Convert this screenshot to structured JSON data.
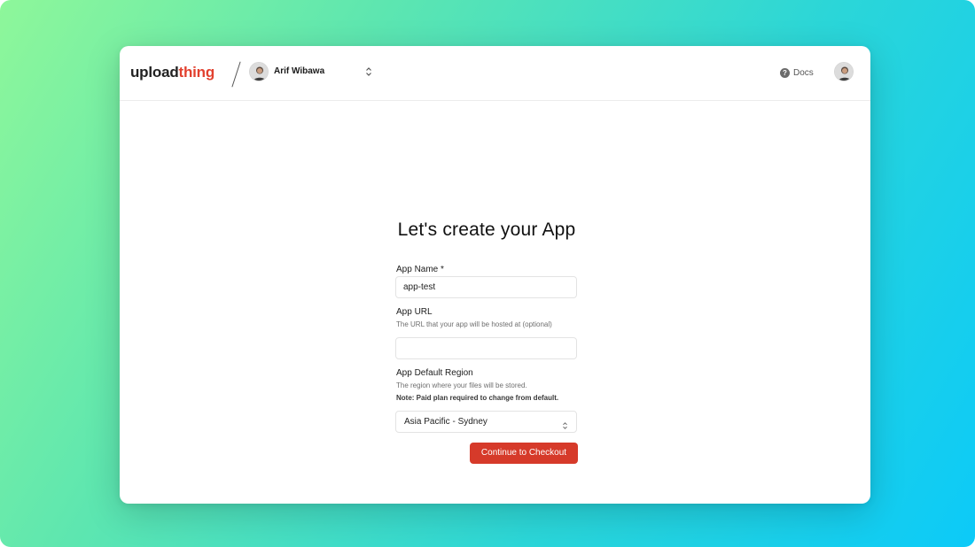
{
  "brand": {
    "logo_part1": "upload",
    "logo_part2": "thing",
    "accent": "#e2412f"
  },
  "account": {
    "name": "Arif Wibawa"
  },
  "header": {
    "docs_label": "Docs"
  },
  "form": {
    "title": "Let's create your App",
    "app_name": {
      "label": "App Name *",
      "value": "app-test"
    },
    "app_url": {
      "label": "App URL",
      "help": "The URL that your app will be hosted at (optional)",
      "value": ""
    },
    "region": {
      "label": "App Default Region",
      "help": "The region where your files will be stored.",
      "note": "Note: Paid plan required to change from default.",
      "selected": "Asia Pacific - Sydney"
    },
    "submit_label": "Continue to Checkout",
    "button_color": "#d63a2a"
  }
}
